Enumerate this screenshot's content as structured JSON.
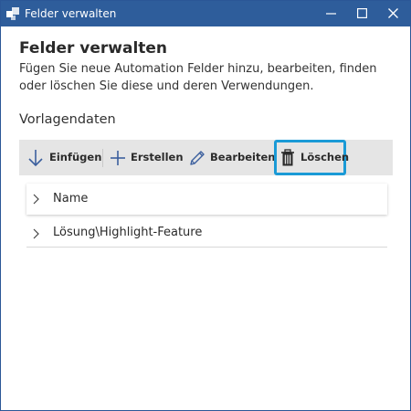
{
  "window": {
    "title": "Felder verwalten",
    "controls": {
      "minimize": "minimize-icon",
      "maximize": "maximize-icon",
      "close": "close-icon"
    }
  },
  "header": {
    "title": "Felder verwalten",
    "description": "Fügen Sie neue Automation Felder hinzu, bearbeiten, finden oder löschen Sie diese und deren Verwendungen."
  },
  "section": {
    "label": "Vorlagendaten"
  },
  "toolbar": {
    "insert": {
      "label": "Einfügen",
      "icon": "arrow-down-icon"
    },
    "create": {
      "label": "Erstellen",
      "icon": "plus-icon"
    },
    "edit": {
      "label": "Bearbeiten",
      "icon": "pencil-icon"
    },
    "delete": {
      "label": "Löschen",
      "icon": "trash-icon",
      "highlighted": true
    }
  },
  "tree": {
    "items": [
      {
        "label": "Name",
        "selected": true
      },
      {
        "label": "Lösung\\Highlight-Feature",
        "selected": false
      }
    ]
  },
  "colors": {
    "titlebar": "#2e5d9b",
    "highlight_border": "#1a9ad6",
    "toolbar_bg": "#e5e5e5",
    "icon_blue": "#3b5f9e"
  }
}
